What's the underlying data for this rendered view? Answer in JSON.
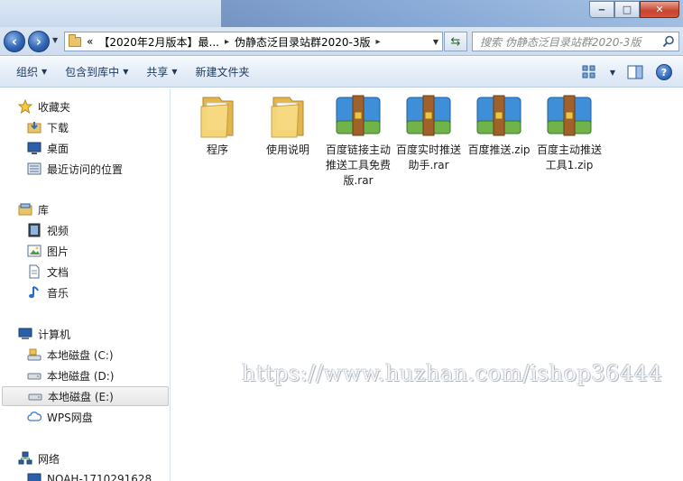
{
  "titlebar": {
    "minimize_label": "‒",
    "maximize_label": "□",
    "close_label": "✕"
  },
  "address": {
    "overflow_marker": "«",
    "crumbs": [
      "【2020年2月版本】最...",
      "伪静态泛目录站群2020-3版"
    ],
    "search_placeholder": "搜索 伪静态泛目录站群2020-3版"
  },
  "toolbar": {
    "organize_label": "组织",
    "include_label": "包含到库中",
    "share_label": "共享",
    "new_folder_label": "新建文件夹"
  },
  "sidebar": {
    "favorites": {
      "label": "收藏夹",
      "items": [
        "下载",
        "桌面",
        "最近访问的位置"
      ]
    },
    "libraries": {
      "label": "库",
      "items": [
        "视频",
        "图片",
        "文档",
        "音乐"
      ]
    },
    "computer": {
      "label": "计算机",
      "items": [
        "本地磁盘 (C:)",
        "本地磁盘 (D:)",
        "本地磁盘 (E:)",
        "WPS网盘"
      ]
    },
    "network": {
      "label": "网络",
      "items": [
        "NOAH-1710291628"
      ]
    }
  },
  "files": [
    {
      "name": "程序",
      "type": "folder"
    },
    {
      "name": "使用说明",
      "type": "folder"
    },
    {
      "name": "百度链接主动推送工具免费版.rar",
      "type": "archive"
    },
    {
      "name": "百度实时推送助手.rar",
      "type": "archive"
    },
    {
      "name": "百度推送.zip",
      "type": "archive"
    },
    {
      "name": "百度主动推送工具1.zip",
      "type": "archive"
    }
  ],
  "watermark": "https://www.huzhan.com/ishop36444",
  "colors": {
    "accent": "#2f63b3",
    "folder": "#e9c46a",
    "archive_blue": "#3f8fd8",
    "archive_strap": "#a0622a"
  }
}
